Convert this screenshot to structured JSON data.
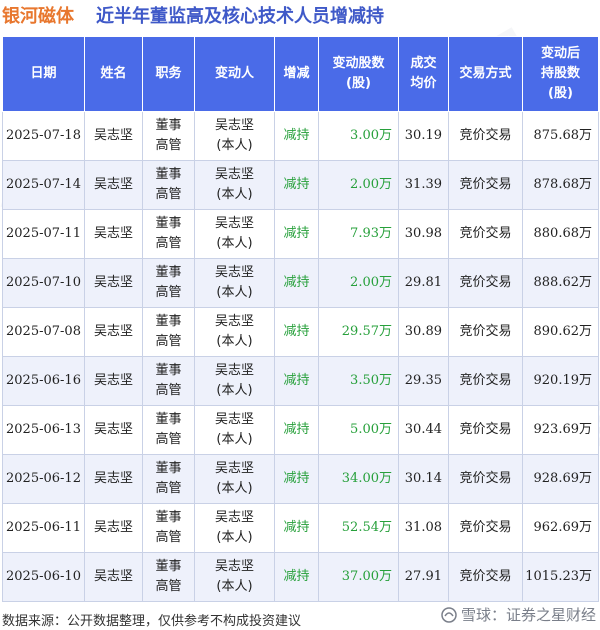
{
  "header": {
    "company": "银河磁体",
    "title": "近半年董监高及核心技术人员增减持"
  },
  "table": {
    "columns": [
      [
        "日期"
      ],
      [
        "姓名"
      ],
      [
        "职务"
      ],
      [
        "变动人"
      ],
      [
        "增减"
      ],
      [
        "变动股数",
        "(股)"
      ],
      [
        "成交",
        "均价"
      ],
      [
        "交易方式"
      ],
      [
        "变动后",
        "持股数",
        "(股)"
      ]
    ],
    "rows": [
      {
        "date": "2025-07-18",
        "name": "吴志坚",
        "role": [
          "董事",
          "高管"
        ],
        "person": [
          "吴志坚",
          "(本人)"
        ],
        "change": "减持",
        "shares": "3.00万",
        "price": "30.19",
        "method": "竞价交易",
        "after": "875.68万"
      },
      {
        "date": "2025-07-14",
        "name": "吴志坚",
        "role": [
          "董事",
          "高管"
        ],
        "person": [
          "吴志坚",
          "(本人)"
        ],
        "change": "减持",
        "shares": "2.00万",
        "price": "31.39",
        "method": "竞价交易",
        "after": "878.68万"
      },
      {
        "date": "2025-07-11",
        "name": "吴志坚",
        "role": [
          "董事",
          "高管"
        ],
        "person": [
          "吴志坚",
          "(本人)"
        ],
        "change": "减持",
        "shares": "7.93万",
        "price": "30.98",
        "method": "竞价交易",
        "after": "880.68万"
      },
      {
        "date": "2025-07-10",
        "name": "吴志坚",
        "role": [
          "董事",
          "高管"
        ],
        "person": [
          "吴志坚",
          "(本人)"
        ],
        "change": "减持",
        "shares": "2.00万",
        "price": "29.81",
        "method": "竞价交易",
        "after": "888.62万"
      },
      {
        "date": "2025-07-08",
        "name": "吴志坚",
        "role": [
          "董事",
          "高管"
        ],
        "person": [
          "吴志坚",
          "(本人)"
        ],
        "change": "减持",
        "shares": "29.57万",
        "price": "30.89",
        "method": "竞价交易",
        "after": "890.62万"
      },
      {
        "date": "2025-06-16",
        "name": "吴志坚",
        "role": [
          "董事",
          "高管"
        ],
        "person": [
          "吴志坚",
          "(本人)"
        ],
        "change": "减持",
        "shares": "3.50万",
        "price": "29.35",
        "method": "竞价交易",
        "after": "920.19万"
      },
      {
        "date": "2025-06-13",
        "name": "吴志坚",
        "role": [
          "董事",
          "高管"
        ],
        "person": [
          "吴志坚",
          "(本人)"
        ],
        "change": "减持",
        "shares": "5.00万",
        "price": "30.44",
        "method": "竞价交易",
        "after": "923.69万"
      },
      {
        "date": "2025-06-12",
        "name": "吴志坚",
        "role": [
          "董事",
          "高管"
        ],
        "person": [
          "吴志坚",
          "(本人)"
        ],
        "change": "减持",
        "shares": "34.00万",
        "price": "30.14",
        "method": "竞价交易",
        "after": "928.69万"
      },
      {
        "date": "2025-06-11",
        "name": "吴志坚",
        "role": [
          "董事",
          "高管"
        ],
        "person": [
          "吴志坚",
          "(本人)"
        ],
        "change": "减持",
        "shares": "52.54万",
        "price": "31.08",
        "method": "竞价交易",
        "after": "962.69万"
      },
      {
        "date": "2025-06-10",
        "name": "吴志坚",
        "role": [
          "董事",
          "高管"
        ],
        "person": [
          "吴志坚",
          "(本人)"
        ],
        "change": "减持",
        "shares": "37.00万",
        "price": "27.91",
        "method": "竞价交易",
        "after": "1015.23万"
      }
    ]
  },
  "footer": {
    "source": "数据来源：公开数据整理，仅供参考不构成投资建议",
    "brand": "雪球：证券之星财经"
  },
  "watermark": "证券之星",
  "colors": {
    "header_bg": "#4a6be8",
    "company": "#e8772e",
    "title": "#3f59c8",
    "change_text": "#27a03b"
  }
}
